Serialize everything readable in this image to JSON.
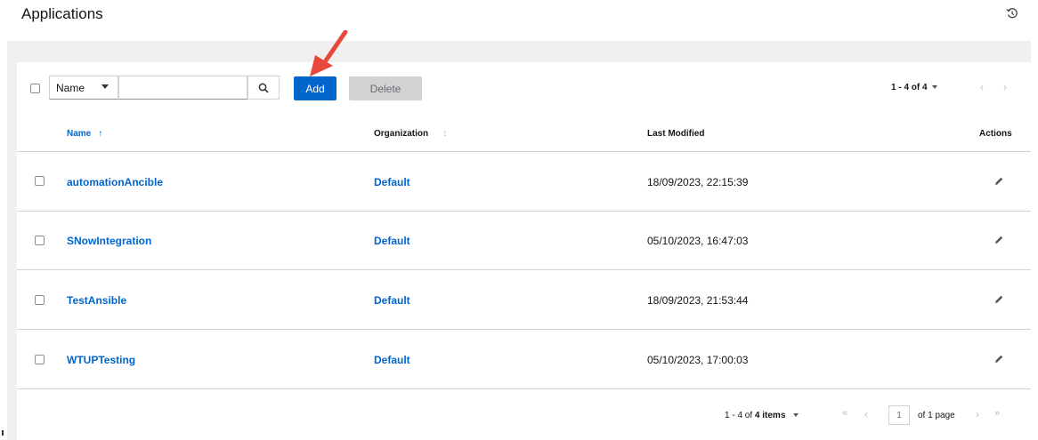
{
  "header": {
    "title": "Applications",
    "history_icon": "history-icon"
  },
  "toolbar": {
    "filter_select_value": "Name",
    "search_value": "",
    "add_label": "Add",
    "delete_label": "Delete",
    "pagination_label": "1 - 4 of 4",
    "add_color": "#0066cc"
  },
  "table": {
    "columns": {
      "name": "Name",
      "name_sort": "↑",
      "organization": "Organization",
      "organization_sort": "↕",
      "last_modified": "Last Modified",
      "actions": "Actions"
    },
    "rows": [
      {
        "name": "automationAncible",
        "organization": "Default",
        "last_modified": "18/09/2023, 22:15:39"
      },
      {
        "name": "SNowIntegration",
        "organization": "Default",
        "last_modified": "05/10/2023, 16:47:03"
      },
      {
        "name": "TestAnsible",
        "organization": "Default",
        "last_modified": "18/09/2023, 21:53:44"
      },
      {
        "name": "WTUPTesting",
        "organization": "Default",
        "last_modified": "05/10/2023, 17:00:03"
      }
    ]
  },
  "footer": {
    "range_prefix": "1 - 4 of",
    "items_label": "4 items",
    "page_value": "1",
    "of_pages_label": "of 1 page"
  },
  "link_color": "#0066cc"
}
